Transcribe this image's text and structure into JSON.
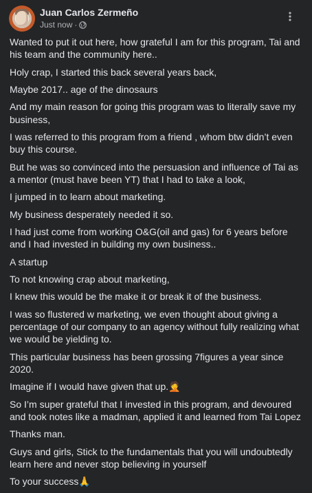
{
  "post": {
    "author": "Juan Carlos Zermeño",
    "time": "Just now",
    "separator": "·",
    "privacy_icon": "globe-icon",
    "more_icon": "more-options-icon",
    "paragraphs": [
      "Wanted to put it out here, how grateful I am for this program, Tai and his team and the community here..",
      "Holy crap, I started this back several years back,",
      "Maybe 2017.. age of the dinosaurs",
      "And my main reason for going this program was to literally save my business,",
      "I was referred to this program from a friend , whom btw didn’t even buy this course.",
      "But he was so convinced into the persuasion and influence of Tai as a mentor (must have been YT) that I had to take a look,",
      "I jumped in to learn about marketing.",
      "My business desperately needed it so.",
      "I had just come from working O&G(oil and gas) for 6 years before and I had invested in building my own business..",
      "A startup",
      "To not knowing crap about marketing,",
      "I knew this would be the make it or break it of the business.",
      "I was so flustered w marketing, we even thought about giving a percentage of our company to an agency without fully realizing what we would be yielding to.",
      "This particular business has been grossing 7figures a year since 2020.",
      "Imagine if I would have given that up.🤦",
      "So I’m super grateful that I invested in this program, and devoured and took notes like a madman, applied it and learned from Tai Lopez",
      "Thanks man.",
      "Guys and girls, Stick to the fundamentals that you will undoubtedly learn here and never stop believing in yourself",
      "To your success🙏"
    ]
  },
  "colors": {
    "background": "#242526",
    "primary_text": "#e4e6eb",
    "secondary_text": "#b0b3b8"
  }
}
